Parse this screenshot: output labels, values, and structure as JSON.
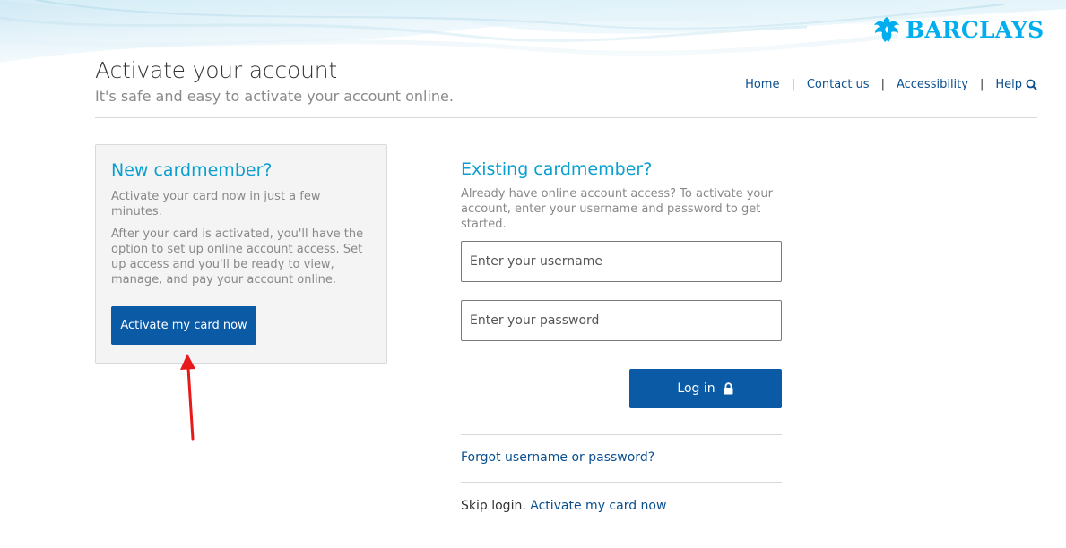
{
  "brand": {
    "name": "BARCLAYS",
    "logo_icon": "eagle-icon",
    "color": "#00aeef"
  },
  "header": {
    "title": "Activate your account",
    "subtitle": "It's safe and easy to activate your account online."
  },
  "topnav": {
    "items": [
      "Home",
      "Contact us",
      "Accessibility",
      "Help"
    ],
    "separator": "|",
    "help_icon": "search-icon"
  },
  "new_cardmember": {
    "heading": "New cardmember?",
    "text1": "Activate your card now in just a few minutes.",
    "text2": "After your card is activated, you'll have the option to set up online account access. Set up access and you'll be ready to view, manage, and pay your account online.",
    "button_label": "Activate my card now"
  },
  "existing_cardmember": {
    "heading": "Existing cardmember?",
    "text": "Already have online account access? To activate your account, enter your username and password to get started.",
    "username_placeholder": "Enter your username",
    "password_placeholder": "Enter your password",
    "login_label": "Log in",
    "login_icon": "lock-icon",
    "forgot_link": "Forgot username or password?",
    "skip_text": "Skip login.",
    "skip_link": "Activate my card now"
  },
  "colors": {
    "primary_button": "#0b5aa6",
    "heading_blue": "#0a9fd0",
    "link_blue": "#0a4f8f",
    "annotation_arrow": "#e8191b"
  }
}
